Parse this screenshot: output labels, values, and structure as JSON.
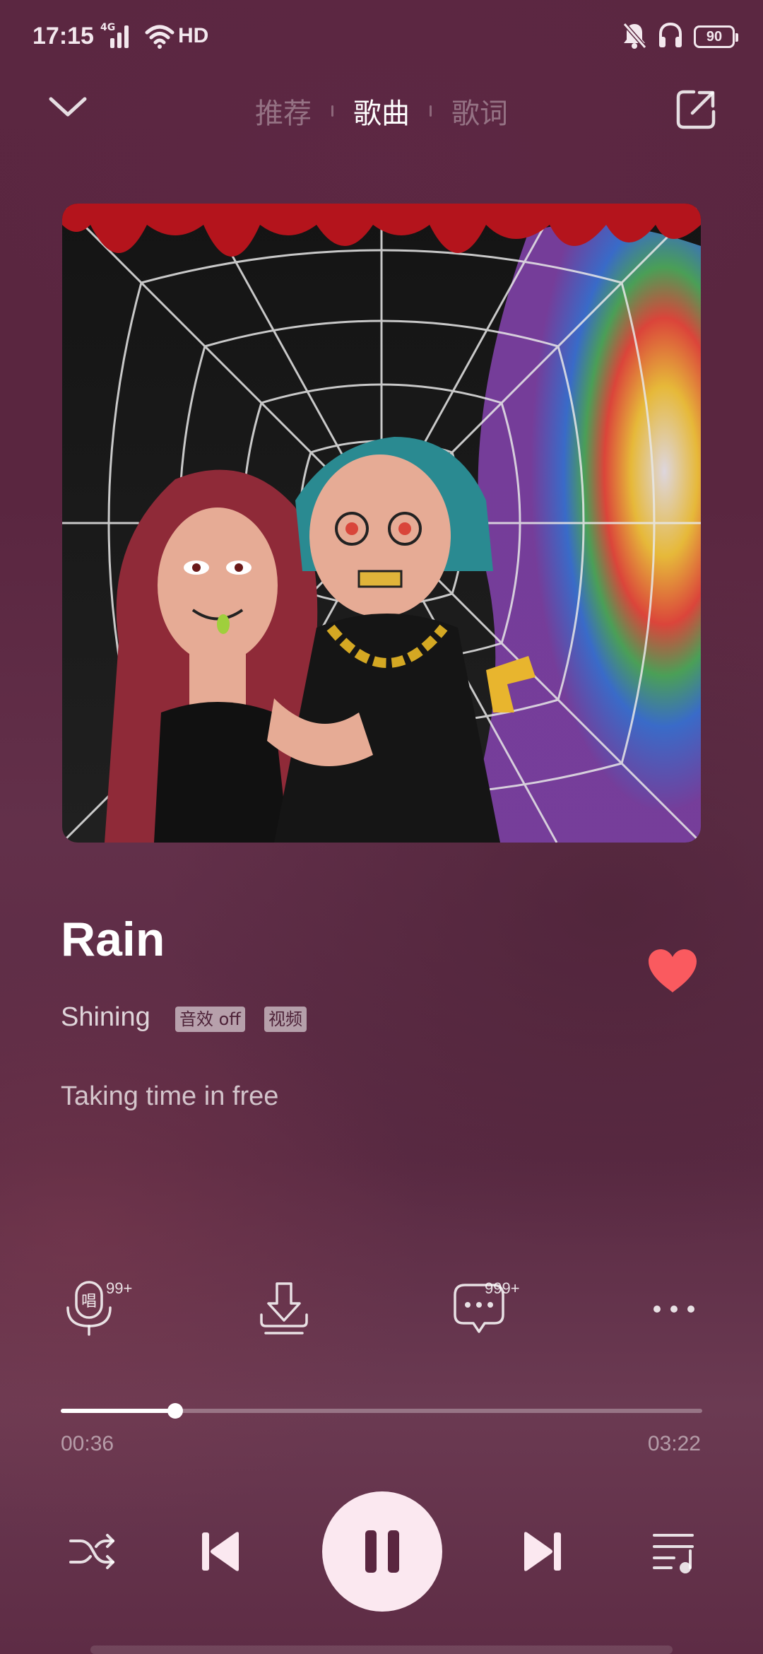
{
  "status_bar": {
    "time": "17:15",
    "network": "4G",
    "hd": "HD",
    "battery": "90"
  },
  "header": {
    "tabs": [
      {
        "label": "推荐",
        "active": false
      },
      {
        "label": "歌曲",
        "active": true
      },
      {
        "label": "歌词",
        "active": false
      }
    ]
  },
  "song": {
    "title": "Rain",
    "artist": "Shining",
    "badges": [
      "音效 off",
      "视频"
    ],
    "liked": true,
    "lyric_line": "Taking time in free"
  },
  "actions": {
    "sing": {
      "icon": "microphone-icon",
      "count": "99+",
      "glyph": "唱"
    },
    "download": {
      "icon": "download-icon"
    },
    "comments": {
      "icon": "comment-icon",
      "count": "999+"
    },
    "more": {
      "icon": "more-icon"
    }
  },
  "progress": {
    "current": "00:36",
    "total": "03:22",
    "fraction": 0.178
  },
  "controls": {
    "shuffle": "shuffle-icon",
    "previous": "previous-icon",
    "play_state": "playing",
    "next": "next-icon",
    "playlist": "playlist-icon"
  },
  "colors": {
    "accent_heart": "#fa5a5f",
    "background": "#5b2741",
    "play_button": "#fbe8f0"
  }
}
